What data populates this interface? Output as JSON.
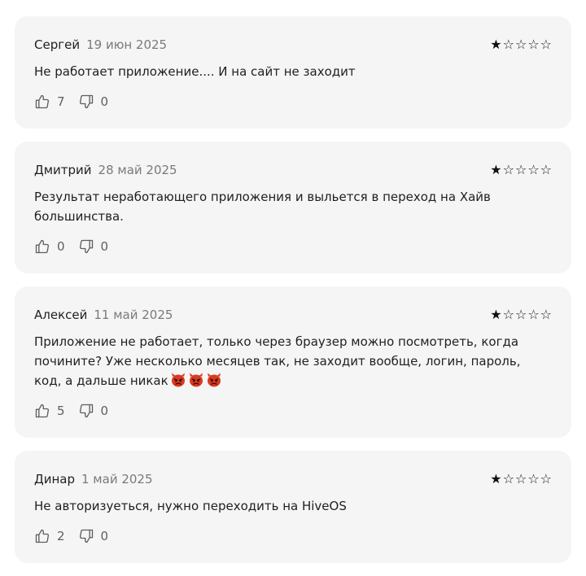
{
  "reviews": [
    {
      "author": "Сергей",
      "date": "19 июн 2025",
      "rating": 1,
      "text": "Не работает приложение.... И на сайт не заходит",
      "likes": "7",
      "dislikes": "0"
    },
    {
      "author": "Дмитрий",
      "date": "28 май 2025",
      "rating": 1,
      "text": "Результат неработающего приложения и выльется в переход на Хайв большинства.",
      "likes": "0",
      "dislikes": "0"
    },
    {
      "author": "Алексей",
      "date": "11 май 2025",
      "rating": 1,
      "text": "Приложение не работает, только через браузер можно посмотреть, когда починитe? Уже несколько месяцев так, не заходит вообще, логин, пароль, код, а дальше никак",
      "emoji": [
        "angry-devil-icon",
        "angry-devil-icon",
        "angry-devil-icon"
      ],
      "likes": "5",
      "dislikes": "0"
    },
    {
      "author": "Динар",
      "date": "1 май 2025",
      "rating": 1,
      "text": "Не авторизуеться, нужно переходить на HiveOS",
      "likes": "2",
      "dislikes": "0"
    }
  ],
  "max_rating": 5,
  "icons": {
    "like": "thumb-up-icon",
    "dislike": "thumb-down-icon",
    "star_filled": "star-filled-icon",
    "star_empty": "star-outline-icon"
  },
  "colors": {
    "card_bg": "#f5f5f5",
    "text": "#1f1f1f",
    "muted": "#7a7a7a",
    "star": "#111111",
    "devil": "#d93a1f"
  }
}
